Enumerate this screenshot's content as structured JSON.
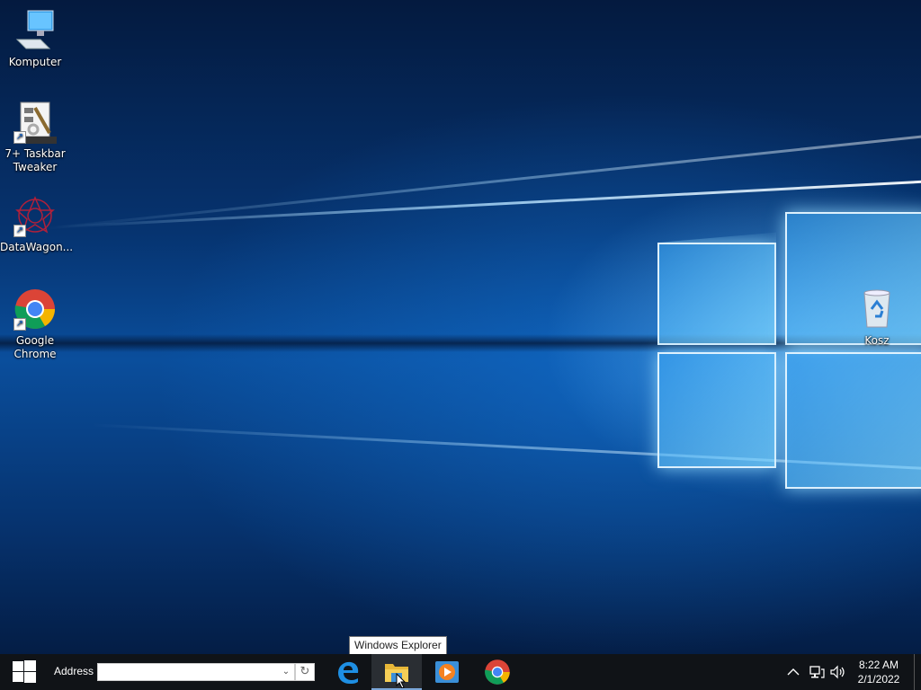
{
  "desktop": {
    "icons": [
      {
        "label": "Komputer"
      },
      {
        "label": "7+ Taskbar Tweaker"
      },
      {
        "label": "DataWagon..."
      },
      {
        "label": "Google Chrome"
      },
      {
        "label": "Kosz"
      }
    ]
  },
  "taskbar": {
    "address_label": "Address",
    "address_value": "",
    "apps": [
      {
        "icon": "edge-icon"
      },
      {
        "icon": "file-explorer-icon",
        "active": true
      },
      {
        "icon": "media-player-icon"
      },
      {
        "icon": "chrome-icon"
      }
    ],
    "tooltip": "Windows Explorer",
    "clock": {
      "time": "8:22 AM",
      "date": "2/1/2022"
    }
  },
  "colors": {
    "taskbar_bg": "#101317",
    "wallpaper_accent": "#0a4e9c",
    "windows_blue": "#00a4ef"
  }
}
